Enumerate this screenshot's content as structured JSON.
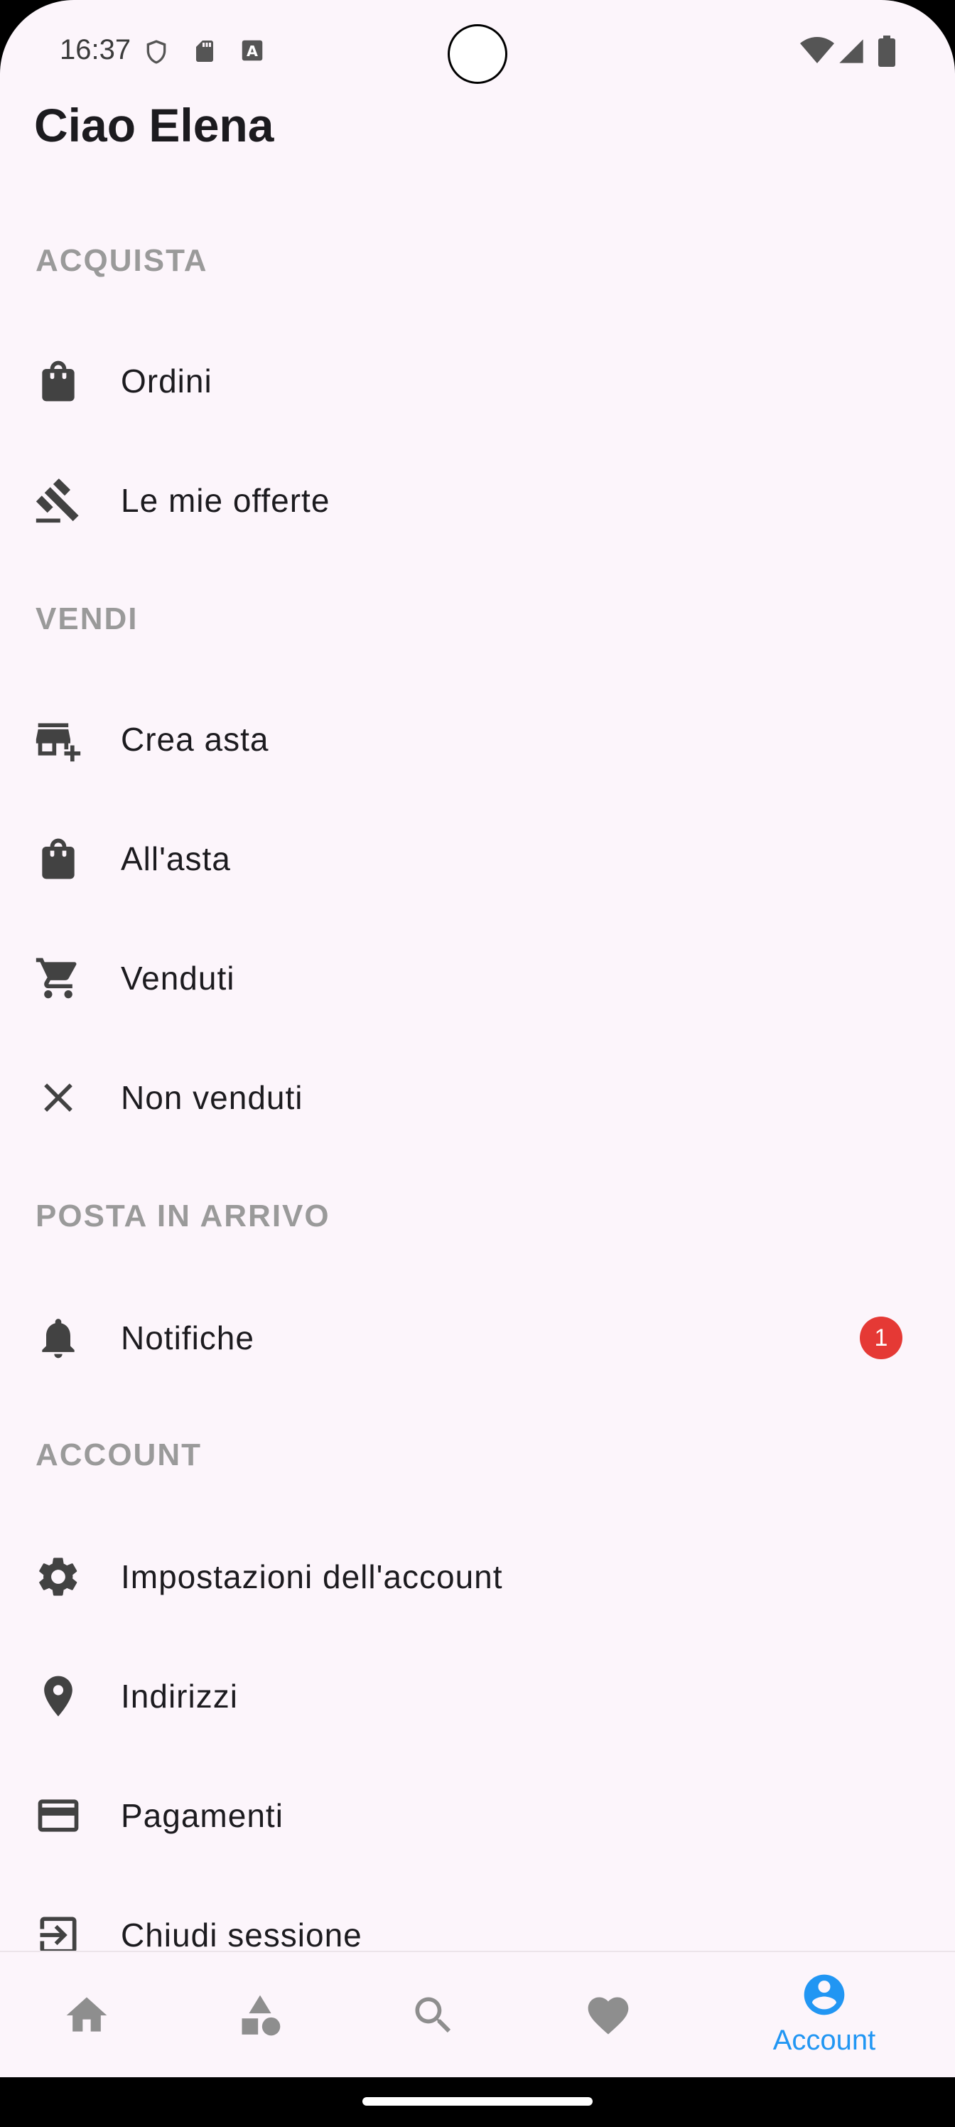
{
  "status_bar": {
    "time": "16:37"
  },
  "header": {
    "greeting": "Ciao Elena"
  },
  "sections": {
    "buy": {
      "title": "ACQUISTA",
      "orders": "Ordini",
      "my_bids": "Le mie offerte"
    },
    "sell": {
      "title": "VENDI",
      "create_auction": "Crea asta",
      "on_auction": "All'asta",
      "sold": "Venduti",
      "unsold": "Non venduti"
    },
    "inbox": {
      "title": "POSTA IN ARRIVO",
      "notifications": "Notifiche",
      "notifications_badge": "1"
    },
    "account": {
      "title": "ACCOUNT",
      "settings": "Impostazioni dell'account",
      "addresses": "Indirizzi",
      "payments": "Pagamenti",
      "logout": "Chiudi sessione"
    }
  },
  "bottom_nav": {
    "items": [
      {
        "icon": "home-icon"
      },
      {
        "icon": "categories-icon"
      },
      {
        "icon": "search-icon"
      },
      {
        "icon": "favorites-icon"
      },
      {
        "icon": "account-icon",
        "label": "Account",
        "active": true
      }
    ]
  },
  "colors": {
    "background": "#fcf5fb",
    "section_title": "#9a9a9a",
    "icon": "#424242",
    "badge": "#e53935",
    "active_nav": "#2196f3",
    "inactive_nav": "#8e8e8e"
  }
}
